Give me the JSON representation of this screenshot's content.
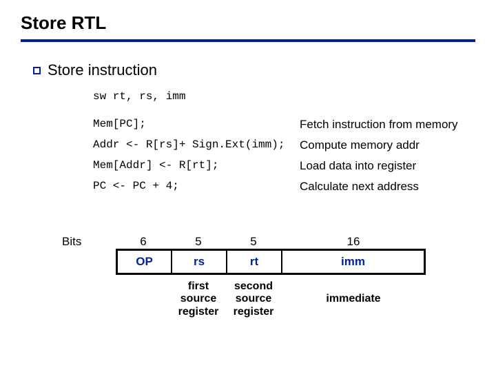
{
  "title": "Store RTL",
  "heading": "Store instruction",
  "syntax": "sw rt, rs, imm",
  "rtl": [
    {
      "code": "Mem[PC];",
      "desc": "Fetch instruction from memory"
    },
    {
      "code": "Addr <- R[rs]+ Sign.Ext(imm);",
      "desc": "Compute memory addr"
    },
    {
      "code": "Mem[Addr] <- R[rt];",
      "desc": "Load data into register"
    },
    {
      "code": "PC <- PC + 4;",
      "desc": "Calculate next address"
    }
  ],
  "table": {
    "bits_label": "Bits",
    "bits": [
      "6",
      "5",
      "5",
      "16"
    ],
    "fields": [
      "OP",
      "rs",
      "rt",
      "imm"
    ],
    "descs": [
      "",
      "first\nsource\nregister",
      "second\nsource\nregister",
      "immediate"
    ]
  }
}
